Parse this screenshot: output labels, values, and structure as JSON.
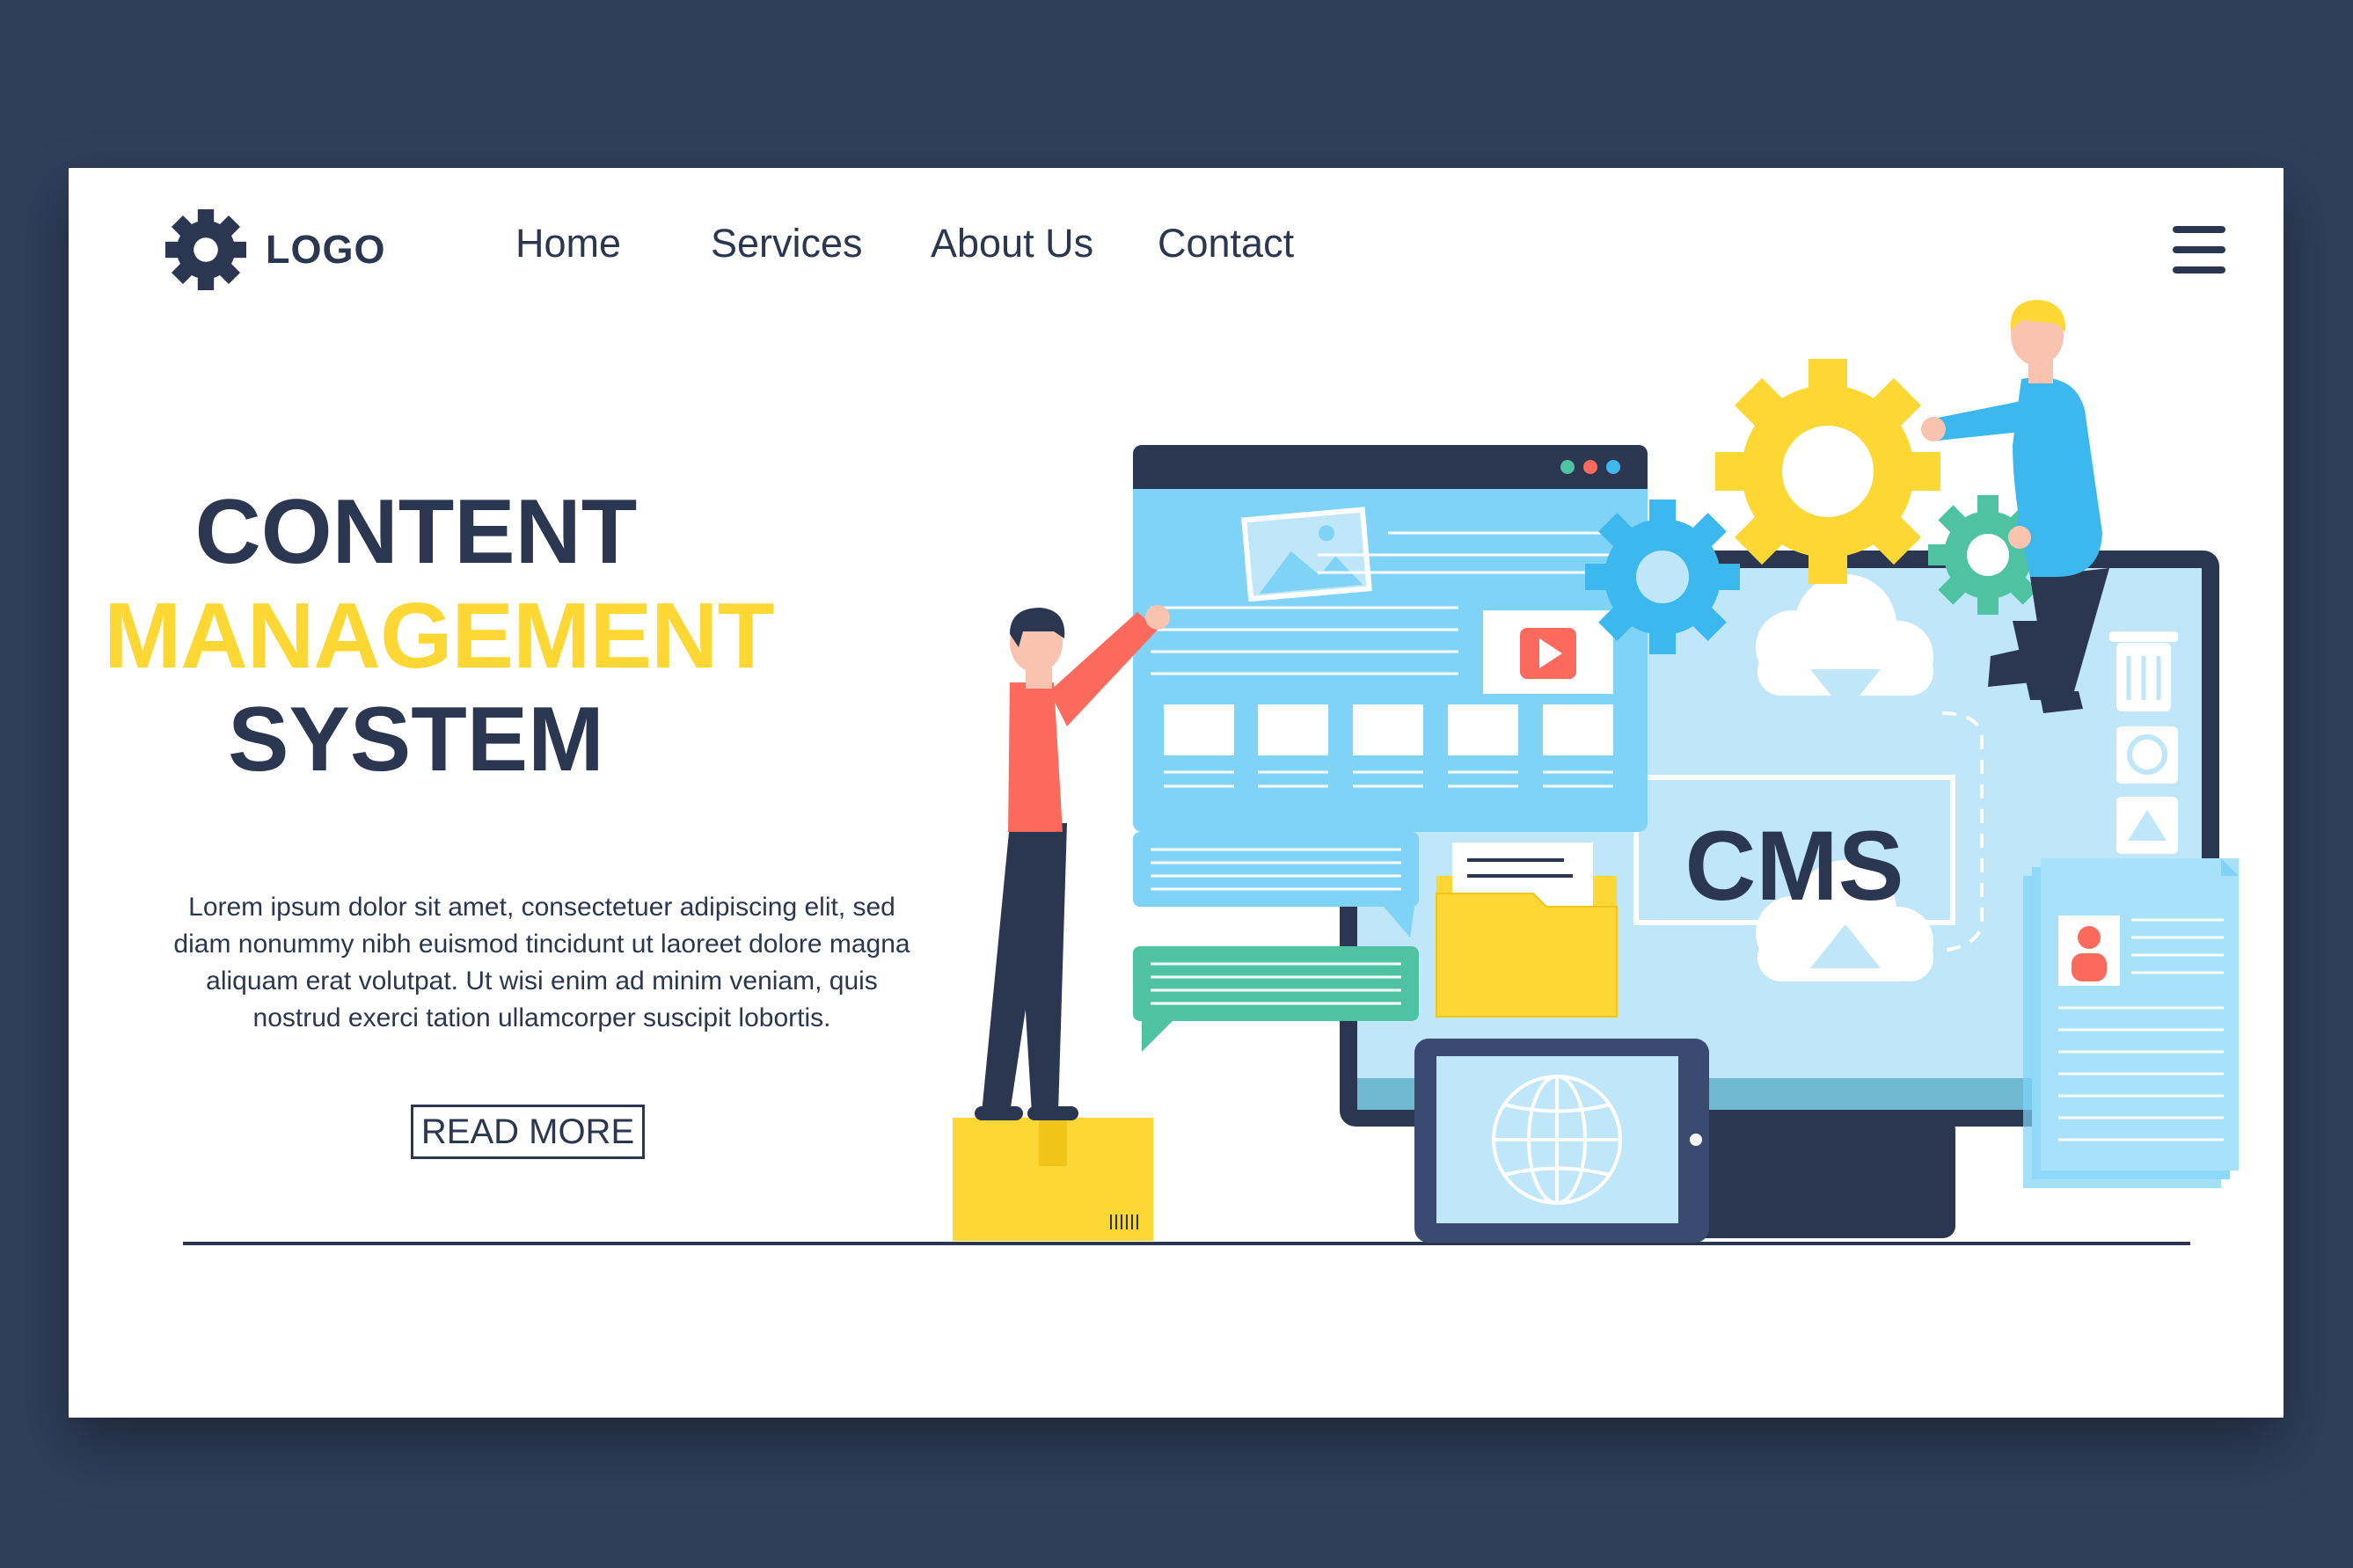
{
  "header": {
    "logo_text": "LOGO",
    "nav": [
      "Home",
      "Services",
      "About Us",
      "Contact"
    ]
  },
  "hero": {
    "title_line1": "CONTENT",
    "title_line2": "MANAGEMENT",
    "title_line3": "SYSTEM",
    "body": "Lorem ipsum dolor sit amet, consectetuer adipiscing elit, sed diam nonummy nibh euismod tincidunt ut laoreet dolore magna aliquam erat volutpat. Ut wisi enim ad minim veniam, quis nostrud exerci tation ullamcorper suscipit lobortis.",
    "cta_label": "READ MORE"
  },
  "illustration": {
    "monitor_label": "CMS"
  },
  "colors": {
    "background": "#2f3e5a",
    "dark_text": "#2b3750",
    "accent_yellow": "#fdd835",
    "screen_blue": "#bfe7f9",
    "window_blue": "#7fd3f6",
    "gear_blue": "#3cb8ef",
    "gear_green": "#4fc3a1",
    "person_red": "#fc6a5d"
  }
}
